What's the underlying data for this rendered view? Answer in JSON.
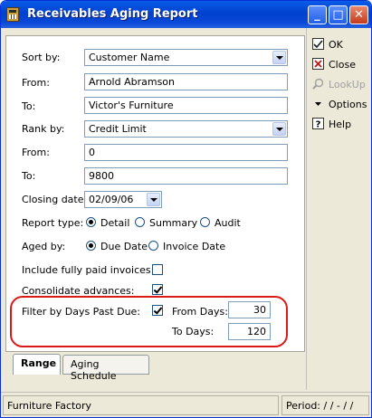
{
  "window": {
    "title": "Receivables Aging Report"
  },
  "form": {
    "sort_by_label": "Sort by:",
    "sort_by_value": "Customer Name",
    "from1_label": "From:",
    "from1_value": "Arnold Abramson",
    "to1_label": "To:",
    "to1_value": "Victor's Furniture",
    "rank_by_label": "Rank by:",
    "rank_by_value": "Credit Limit",
    "from2_label": "From:",
    "from2_value": "0",
    "to2_label": "To:",
    "to2_value": "9800",
    "closing_date_label": "Closing date:",
    "closing_date_value": "02/09/06",
    "report_type_label": "Report type:",
    "report_type_options": [
      "Detail",
      "Summary",
      "Audit"
    ],
    "report_type_selected": "Detail",
    "aged_by_label": "Aged by:",
    "aged_by_options": [
      "Due Date",
      "Invoice Date"
    ],
    "aged_by_selected": "Due Date",
    "include_paid_label": "Include fully paid invoices:",
    "include_paid_checked": false,
    "consolidate_label": "Consolidate advances:",
    "consolidate_checked": true,
    "filter_label": "Filter by Days Past Due:",
    "filter_checked": true,
    "from_days_label": "From Days:",
    "from_days_value": "30",
    "to_days_label": "To Days:",
    "to_days_value": "120"
  },
  "tabs": [
    {
      "label": "Range",
      "active": true
    },
    {
      "label": "Aging Schedule",
      "active": false
    }
  ],
  "sidebar": {
    "items": [
      {
        "label": "OK",
        "icon": "ok-icon",
        "enabled": true
      },
      {
        "label": "Close",
        "icon": "close-icon",
        "enabled": true
      },
      {
        "label": "LookUp",
        "icon": "lookup-icon",
        "enabled": false
      },
      {
        "label": "Options",
        "icon": "triangle-down-icon",
        "enabled": true
      },
      {
        "label": "Help",
        "icon": "help-icon",
        "enabled": true
      }
    ]
  },
  "status": {
    "company": "Furniture Factory",
    "period": "Period: / /  -  / /"
  },
  "colors": {
    "titlebar": "#0a5ce8",
    "window_bg": "#ece9d8",
    "highlight": "#d81a1a",
    "radio_dot": "#21a121"
  }
}
